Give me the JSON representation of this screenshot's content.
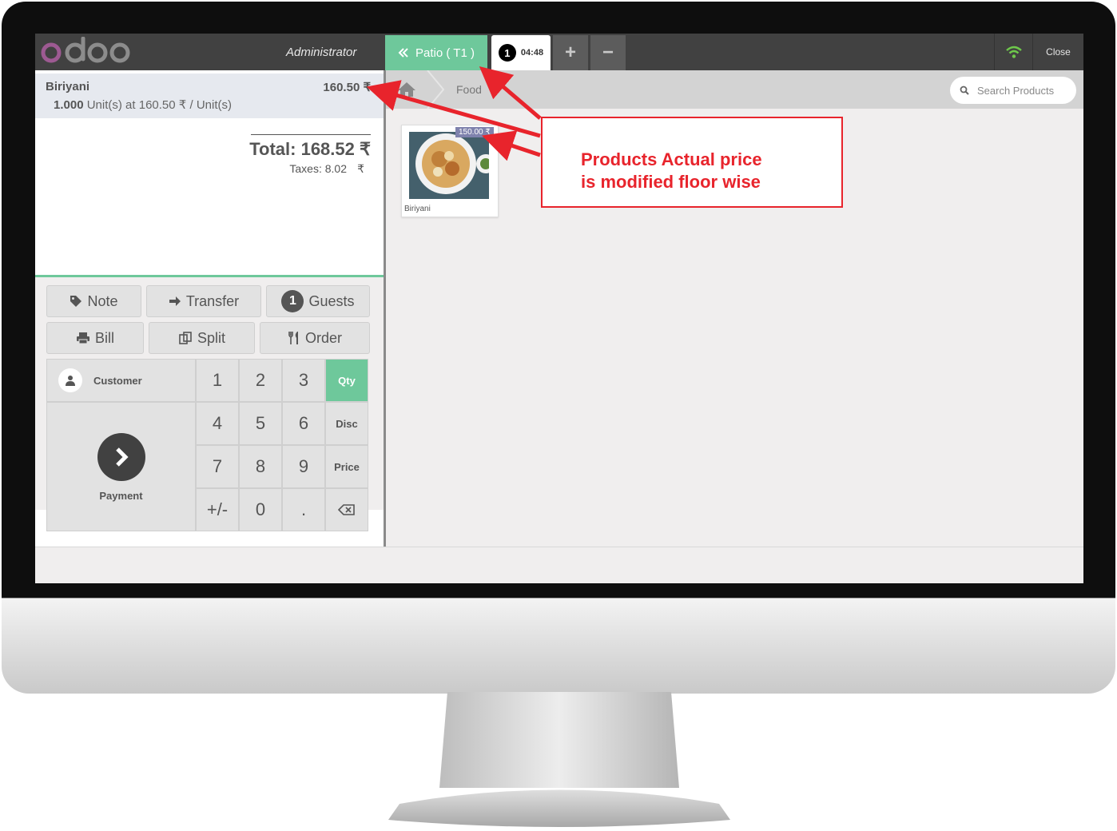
{
  "topbar": {
    "logo_text": "odoo",
    "user": "Administrator",
    "floor_button": "Patio ( T1 )",
    "order_badge": "1",
    "order_time": "04:48",
    "plus_label": "+",
    "minus_label": "−",
    "close_label": "Close"
  },
  "orderline": {
    "product": "Biriyani",
    "price": "160.50 ₹",
    "qty": "1.000",
    "detail": "Unit(s) at 160.50 ₹ / Unit(s)"
  },
  "summary": {
    "total": "Total: 168.52 ₹",
    "taxes": "Taxes: 8.02",
    "taxes_symbol": "₹"
  },
  "controls": {
    "note": "Note",
    "transfer": "Transfer",
    "guests_count": "1",
    "guests": "Guests",
    "bill": "Bill",
    "split": "Split",
    "order": "Order",
    "customer": "Customer",
    "payment": "Payment"
  },
  "numpad": {
    "keys": [
      "1",
      "2",
      "3",
      "4",
      "5",
      "6",
      "7",
      "8",
      "9",
      "+/-",
      "0",
      "."
    ],
    "qty": "Qty",
    "disc": "Disc",
    "price": "Price"
  },
  "products": {
    "breadcrumb": "Food",
    "search_placeholder": "Search Products",
    "items": [
      {
        "name": "Biriyani",
        "price": "150.00 ₹"
      }
    ]
  },
  "annotation": {
    "line1": "Products Actual price",
    "line2": "is modified floor wise"
  },
  "colors": {
    "accent": "#6ec89b",
    "topbar": "#414141",
    "annotation": "#e8242c",
    "price_tag": "#7f82ad"
  }
}
